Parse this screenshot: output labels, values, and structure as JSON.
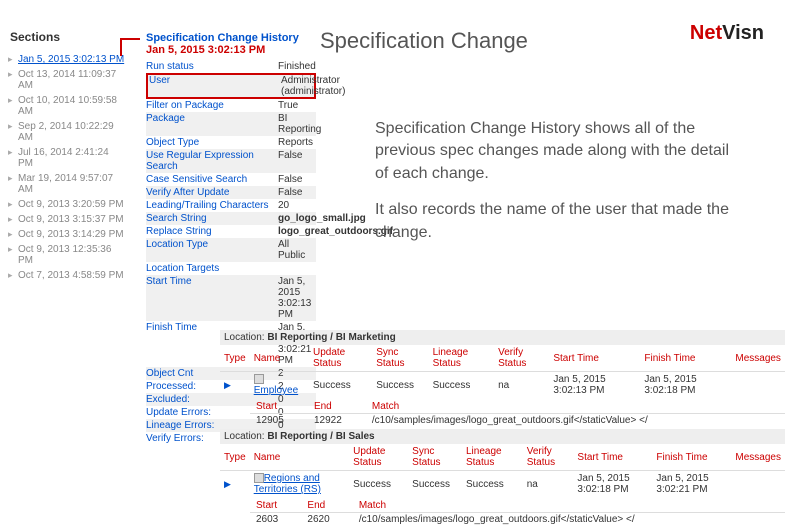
{
  "logo_net": "Net",
  "logo_visn": "Visn",
  "title_main": "Specification Change",
  "sidebar": {
    "header": "Sections",
    "items": [
      "Jan 5, 2015 3:02:13 PM",
      "Oct 13, 2014 11:09:37 AM",
      "Oct 10, 2014 10:59:58 AM",
      "Sep 2, 2014 10:22:29 AM",
      "Jul 16, 2014 2:41:24 PM",
      "Mar 19, 2014 9:57:07 AM",
      "Oct 9, 2013 3:20:59 PM",
      "Oct 9, 2013 3:15:37 PM",
      "Oct 9, 2013 3:14:29 PM",
      "Oct 9, 2013 12:35:36 PM",
      "Oct 7, 2013 4:58:59 PM"
    ]
  },
  "detail": {
    "title": "Specification Change History",
    "date": "Jan 5, 2015 3:02:13 PM",
    "rows": [
      {
        "k": "Run status",
        "v": "Finished"
      },
      {
        "k": "User",
        "v": "Administrator (administrator)"
      },
      {
        "k": "Filter on Package",
        "v": "True"
      },
      {
        "k": "Package",
        "v": "BI Reporting"
      },
      {
        "k": "Object Type",
        "v": "Reports"
      },
      {
        "k": "Use Regular Expression Search",
        "v": "False"
      },
      {
        "k": "Case Sensitive Search",
        "v": "False"
      },
      {
        "k": "Verify After Update",
        "v": "False"
      },
      {
        "k": "Leading/Trailing Characters",
        "v": "20"
      },
      {
        "k": "Search String",
        "v": "go_logo_small.jpg"
      },
      {
        "k": "Replace String",
        "v": "logo_great_outdoors.gif"
      },
      {
        "k": "Location Type",
        "v": "All Public"
      },
      {
        "k": "Location Targets",
        "v": ""
      },
      {
        "k": "Start Time",
        "v": "Jan 5, 2015 3:02:13 PM"
      },
      {
        "k": "Finish Time",
        "v": "Jan 5, 2015 3:02:21 PM"
      },
      {
        "k": "Object Cnt",
        "v": "2"
      },
      {
        "k": "Processed:",
        "v": "2"
      },
      {
        "k": "Excluded:",
        "v": "0"
      },
      {
        "k": "Update Errors:",
        "v": "0"
      },
      {
        "k": "Lineage Errors:",
        "v": "0"
      },
      {
        "k": "Verify Errors:",
        "v": ""
      }
    ]
  },
  "desc": {
    "p1": "Specification Change History shows all of the previous spec changes made along with the detail of each change.",
    "p2": "It also records the name of the user that made the change."
  },
  "results": {
    "headers": [
      "Type",
      "Name",
      "Update Status",
      "Sync Status",
      "Lineage Status",
      "Verify Status",
      "Start Time",
      "Finish Time",
      "Messages"
    ],
    "match_headers": [
      "Start",
      "End",
      "Match"
    ],
    "loc_label": "Location: ",
    "groups": [
      {
        "location": "BI Reporting / BI Marketing",
        "row": {
          "name": "Employee",
          "update": "Success",
          "sync": "Success",
          "lineage": "Success",
          "verify": "na",
          "start": "Jan 5, 2015 3:02:13 PM",
          "finish": "Jan 5, 2015 3:02:18 PM",
          "msg": ""
        },
        "match": {
          "start": "12905",
          "end": "12922",
          "text": "/c10/samples/images/logo_great_outdoors.gif</staticValue> </"
        }
      },
      {
        "location": "BI Reporting / BI Sales",
        "row": {
          "name": "Regions and Territories (RS)",
          "update": "Success",
          "sync": "Success",
          "lineage": "Success",
          "verify": "na",
          "start": "Jan 5, 2015 3:02:18 PM",
          "finish": "Jan 5, 2015 3:02:21 PM",
          "msg": ""
        },
        "match": {
          "start": "2603",
          "end": "2620",
          "text": "/c10/samples/images/logo_great_outdoors.gif</staticValue> </"
        }
      }
    ]
  }
}
